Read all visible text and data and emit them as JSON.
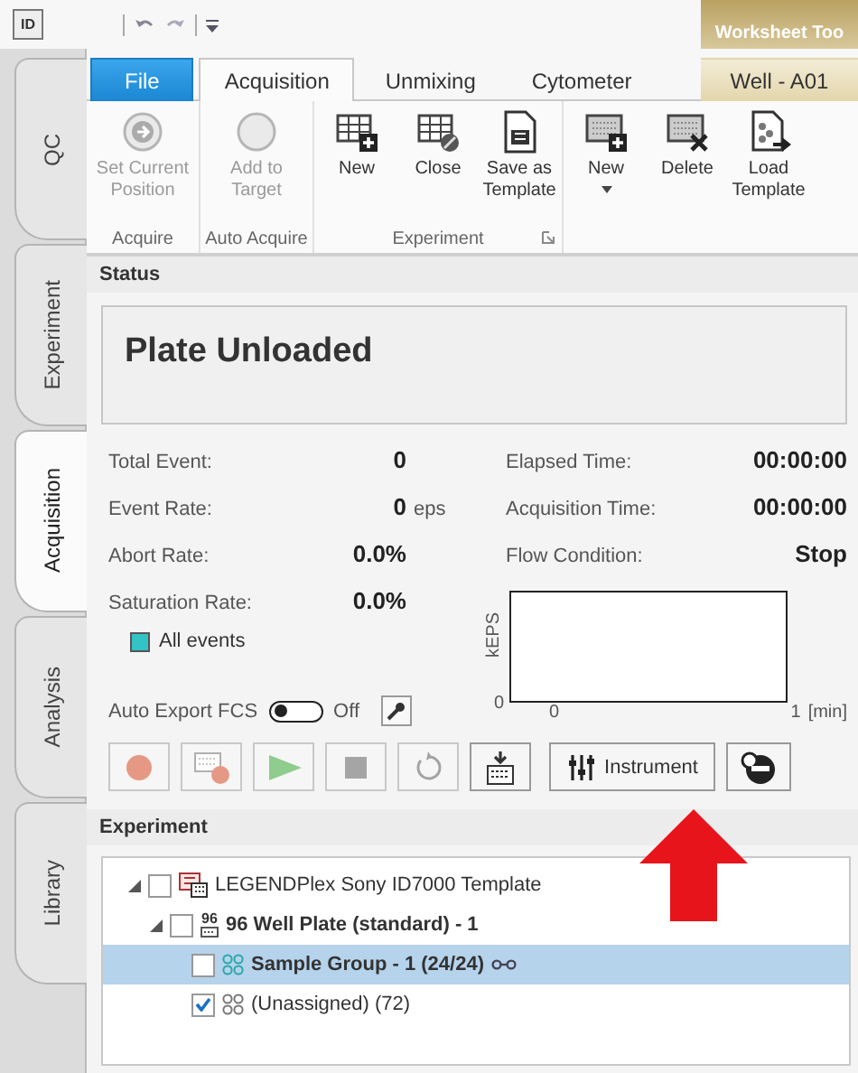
{
  "title_bar": {
    "app_icon": "ID",
    "contextual_group": "Worksheet Too"
  },
  "side_tabs": [
    {
      "label": "QC",
      "selected": false
    },
    {
      "label": "Experiment",
      "selected": false
    },
    {
      "label": "Acquisition",
      "selected": true
    },
    {
      "label": "Analysis",
      "selected": false
    },
    {
      "label": "Library",
      "selected": false
    }
  ],
  "ribbon_tabs": [
    {
      "label": "File",
      "kind": "file",
      "selected": false
    },
    {
      "label": "Acquisition",
      "kind": "tab",
      "selected": true
    },
    {
      "label": "Unmixing",
      "kind": "tab",
      "selected": false
    },
    {
      "label": "Cytometer",
      "kind": "tab",
      "selected": false
    },
    {
      "label": "Well - A01",
      "kind": "contextual",
      "selected": false
    }
  ],
  "ribbon_groups": [
    {
      "label": "Acquire",
      "buttons": [
        {
          "label": "Set Current Position",
          "kind": "arrow-circle",
          "disabled": true
        }
      ]
    },
    {
      "label": "Auto Acquire",
      "buttons": [
        {
          "label": "Add to Target",
          "kind": "circle",
          "disabled": true
        }
      ]
    },
    {
      "label": "Experiment",
      "launcher": true,
      "buttons": [
        {
          "label": "New",
          "kind": "sheet-new",
          "disabled": false
        },
        {
          "label": "Close",
          "kind": "sheet-close",
          "disabled": false
        },
        {
          "label": "Save as Template",
          "kind": "template-save",
          "disabled": false
        }
      ]
    },
    {
      "buttons": [
        {
          "label": "New",
          "kind": "plate-new",
          "disabled": false,
          "dropdown": true
        },
        {
          "label": "Delete",
          "kind": "plate-delete",
          "disabled": false
        },
        {
          "label": "Load Template",
          "kind": "template-load",
          "disabled": false
        }
      ]
    }
  ],
  "status": {
    "header": "Status",
    "message": "Plate Unloaded",
    "left_stats": [
      {
        "label": "Total Event:",
        "value": "0"
      },
      {
        "label": "Event Rate:",
        "value": "0",
        "unit": "eps"
      },
      {
        "label": "Abort Rate:",
        "value": "0.0%"
      },
      {
        "label": "Saturation Rate:",
        "value": "0.0%"
      }
    ],
    "right_stats": [
      {
        "label": "Elapsed Time:",
        "value": "00:00:00"
      },
      {
        "label": "Acquisition Time:",
        "value": "00:00:00"
      },
      {
        "label": "Flow Condition:",
        "value": "Stop"
      }
    ],
    "legend": [
      {
        "label": "All events",
        "color": "#33c2c6"
      }
    ],
    "flow_plot": {
      "ylabel": "kEPS",
      "ytick": "0",
      "xticks": [
        "0",
        "1"
      ],
      "xunit": "[min]"
    },
    "auto_export": {
      "label": "Auto Export FCS",
      "on": false,
      "state_text": "Off"
    },
    "controls": [
      {
        "kind": "record",
        "disabled": true
      },
      {
        "kind": "plate-record",
        "disabled": true
      },
      {
        "kind": "play",
        "disabled": true
      },
      {
        "kind": "stop",
        "disabled": true
      },
      {
        "kind": "refresh",
        "disabled": true
      },
      {
        "kind": "plate-load",
        "disabled": false
      },
      {
        "kind": "instrument",
        "label": "Instrument",
        "disabled": false
      },
      {
        "kind": "eject",
        "disabled": false
      }
    ]
  },
  "experiment": {
    "header": "Experiment",
    "tree": [
      {
        "label": "LEGENDPlex Sony ID7000 Template",
        "kind": "template",
        "checked": false,
        "expanded": true,
        "selected": false,
        "children": [
          {
            "label": "96 Well Plate (standard) - 1",
            "kind": "plate",
            "badge": "96",
            "checked": false,
            "expanded": true,
            "selected": false,
            "children": [
              {
                "label": "Sample Group - 1 (24/24)",
                "kind": "group",
                "linked": true,
                "checked": false,
                "selected": true
              },
              {
                "label": "(Unassigned) (72)",
                "kind": "unassigned",
                "checked": true,
                "selected": false
              }
            ]
          }
        ]
      }
    ]
  }
}
